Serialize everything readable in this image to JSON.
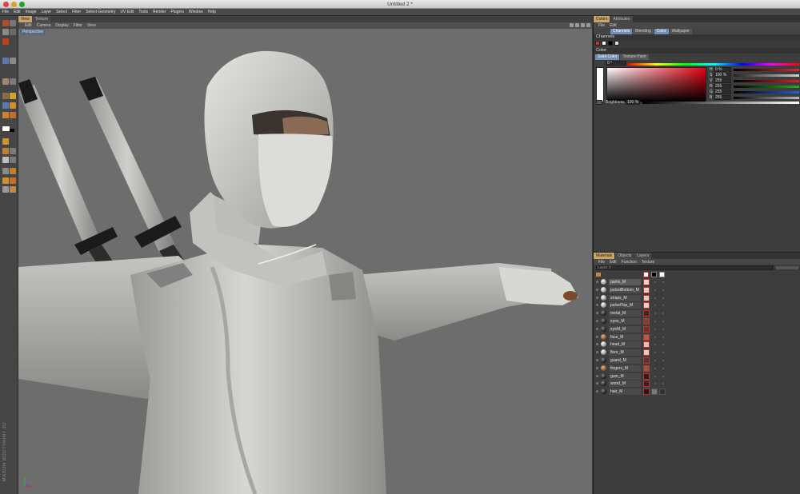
{
  "window": {
    "title": "Untitled 2 *"
  },
  "menu": [
    "File",
    "Edit",
    "Image",
    "Layer",
    "Select",
    "Filter",
    "Select Geometry",
    "UV Edit",
    "Tools",
    "Render",
    "Plugins",
    "Window",
    "Help"
  ],
  "viewport": {
    "tabs": [
      "View",
      "Texture"
    ],
    "menu": [
      "Edit",
      "Camera",
      "Display",
      "Filter",
      "View"
    ],
    "label": "Perspective"
  },
  "brand": "MAXON BODYPAINT 3D",
  "color_panel": {
    "tabs": [
      "Colors",
      "Attributes"
    ],
    "menu": [
      "File",
      "Edit"
    ],
    "channel_tabs": [
      "Channels",
      "Blending",
      "Color",
      "Wallpaper"
    ],
    "channels_heading": "Channels",
    "color_heading": "Color",
    "sub_tabs": [
      "Solid Color",
      "Texture Paint"
    ],
    "angle": "0 °",
    "fields": [
      {
        "label": "H",
        "value": "0 %",
        "color": "#d03030"
      },
      {
        "label": "S",
        "value": "100 %",
        "color": "#cfcfcf"
      },
      {
        "label": "V",
        "value": "255",
        "color": "#e02020"
      },
      {
        "label": "R",
        "value": "255",
        "color": "#20b020"
      },
      {
        "label": "G",
        "value": "255",
        "color": "#2060e0"
      },
      {
        "label": "B",
        "value": "255",
        "color": "#bbbbbb"
      }
    ],
    "brightness_label": "Brightness",
    "brightness_value": "100 %"
  },
  "materials_panel": {
    "tabs": [
      "Materials",
      "Objects",
      "Layers"
    ],
    "menu": [
      "File",
      "Edit",
      "Function",
      "Texture"
    ],
    "filter_placeholder": "Layer 0",
    "items": [
      {
        "name": "pants_M",
        "ball": "light",
        "chan": "#e8d8d0"
      },
      {
        "name": "jacketBottom_M",
        "ball": "light",
        "chan": "#e0d2cc"
      },
      {
        "name": "straps_M",
        "ball": "light",
        "chan": "#d8ccc6"
      },
      {
        "name": "jacketTop_M",
        "ball": "light",
        "chan": "#e4d6cf"
      },
      {
        "name": "metal_M",
        "ball": "dark",
        "chan": "#3a2a2a"
      },
      {
        "name": "eyes_M",
        "ball": "dark",
        "chan": "#6a4a3a"
      },
      {
        "name": "eyeM_M",
        "ball": "dark",
        "chan": "#5a3a2a"
      },
      {
        "name": "face_M",
        "ball": "brown",
        "chan": "#9a6a4a"
      },
      {
        "name": "head_M",
        "ball": "light",
        "chan": "#d4c4bc"
      },
      {
        "name": "floor_M",
        "ball": "light",
        "chan": "#dcd0c8"
      },
      {
        "name": "guard_M",
        "ball": "dark",
        "chan": "#4a3a34"
      },
      {
        "name": "fingers_M",
        "ball": "brown",
        "chan": "#8a5a3a"
      },
      {
        "name": "gum_M",
        "ball": "dark",
        "chan": "#2a2020"
      },
      {
        "name": "wood_M",
        "ball": "dark",
        "chan": "#302420"
      },
      {
        "name": "hair_M",
        "ball": "dark",
        "chan": "#1e1a18"
      }
    ]
  }
}
